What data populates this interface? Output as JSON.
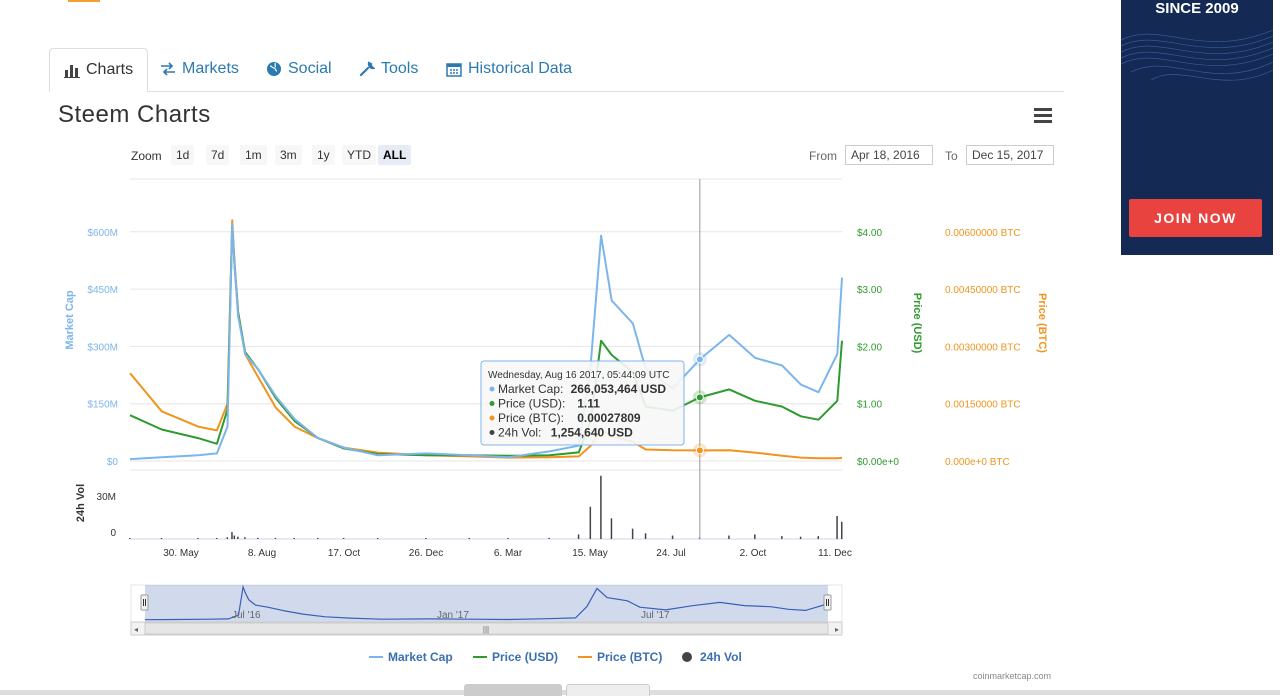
{
  "tabs": [
    {
      "label": "Charts",
      "icon": "bar-chart-icon",
      "active": true
    },
    {
      "label": "Markets",
      "icon": "exchange-icon",
      "active": false
    },
    {
      "label": "Social",
      "icon": "globe-icon",
      "active": false
    },
    {
      "label": "Tools",
      "icon": "wrench-icon",
      "active": false
    },
    {
      "label": "Historical Data",
      "icon": "calendar-icon",
      "active": false
    }
  ],
  "ad": {
    "headline": "SINCE 2009",
    "cta": "JOIN NOW"
  },
  "colors": {
    "market_cap": "#7cb5ec",
    "price_usd": "#2f9a2f",
    "price_btc": "#f0941f",
    "volume": "#434348",
    "navigator": "#3a5fb8"
  },
  "zoom": {
    "label": "Zoom",
    "buttons": [
      "1d",
      "7d",
      "1m",
      "3m",
      "1y",
      "YTD",
      "ALL"
    ],
    "selected": "ALL"
  },
  "range": {
    "from_label": "From",
    "from_value": "Apr 18, 2016",
    "to_label": "To",
    "to_value": "Dec 15, 2017"
  },
  "tooltip": {
    "date": "Wednesday, Aug 16 2017, 05:44:09 UTC",
    "rows": [
      {
        "label": "Market Cap:",
        "value": "266,053,464 USD"
      },
      {
        "label": "Price (USD):",
        "value": "1.11"
      },
      {
        "label": "Price (BTC):",
        "value": "0.00027809"
      },
      {
        "label": "24h Vol:",
        "value": "1,254,640 USD"
      }
    ]
  },
  "chart_data": {
    "type": "line",
    "title": "Steem Charts",
    "x_ticks": [
      "30. May",
      "8. Aug",
      "17. Oct",
      "26. Dec",
      "6. Mar",
      "15. May",
      "24. Jul",
      "2. Oct",
      "11. Dec"
    ],
    "axes": {
      "market_cap": {
        "label": "Market Cap",
        "ticks": [
          "$0",
          "$150M",
          "$300M",
          "$450M",
          "$600M"
        ],
        "range": [
          0,
          600000000
        ]
      },
      "price_usd": {
        "label": "Price (USD)",
        "ticks": [
          "$0.00e+0",
          "$1.00",
          "$2.00",
          "$3.00",
          "$4.00"
        ],
        "range": [
          0,
          4
        ]
      },
      "price_btc": {
        "label": "Price (BTC)",
        "ticks": [
          "0.000e+0 BTC",
          "0.00150000 BTC",
          "0.00300000 BTC",
          "0.00450000 BTC",
          "0.00600000 BTC"
        ],
        "range": [
          0,
          0.006
        ]
      },
      "volume": {
        "label": "24h Vol",
        "ticks": [
          "0",
          "30M"
        ],
        "range": [
          0,
          60000000
        ]
      }
    },
    "x": [
      "2016-04-18",
      "2016-05-15",
      "2016-06-15",
      "2016-07-01",
      "2016-07-10",
      "2016-07-14",
      "2016-07-16",
      "2016-07-19",
      "2016-07-25",
      "2016-08-05",
      "2016-08-20",
      "2016-09-05",
      "2016-09-25",
      "2016-10-17",
      "2016-11-15",
      "2016-12-26",
      "2017-02-01",
      "2017-03-06",
      "2017-04-10",
      "2017-05-05",
      "2017-05-15",
      "2017-05-24",
      "2017-06-02",
      "2017-06-20",
      "2017-07-01",
      "2017-07-24",
      "2017-08-16",
      "2017-09-10",
      "2017-10-02",
      "2017-10-25",
      "2017-11-10",
      "2017-11-25",
      "2017-12-11",
      "2017-12-15"
    ],
    "series": [
      {
        "name": "Market Cap",
        "axis": "market_cap",
        "values": [
          5000000,
          10000000,
          15000000,
          20000000,
          90000000,
          620000000,
          510000000,
          380000000,
          280000000,
          240000000,
          170000000,
          110000000,
          60000000,
          35000000,
          15000000,
          20000000,
          15000000,
          10000000,
          25000000,
          40000000,
          250000000,
          590000000,
          420000000,
          360000000,
          240000000,
          190000000,
          266000000,
          330000000,
          270000000,
          250000000,
          200000000,
          180000000,
          280000000,
          480000000
        ]
      },
      {
        "name": "Price (USD)",
        "axis": "price_usd",
        "values": [
          0.8,
          0.55,
          0.4,
          0.3,
          0.9,
          4.1,
          3.4,
          2.6,
          1.9,
          1.6,
          1.1,
          0.7,
          0.4,
          0.22,
          0.12,
          0.1,
          0.1,
          0.09,
          0.1,
          0.15,
          0.7,
          2.1,
          1.85,
          1.55,
          0.95,
          0.88,
          1.11,
          1.25,
          1.05,
          0.95,
          0.78,
          0.72,
          1.05,
          2.1
        ]
      },
      {
        "name": "Price (BTC)",
        "axis": "price_btc",
        "values": [
          0.0023,
          0.0013,
          0.0009,
          0.0008,
          0.0015,
          0.0063,
          0.0052,
          0.0039,
          0.0028,
          0.0022,
          0.0014,
          0.0009,
          0.0006,
          0.00035,
          0.00022,
          0.00015,
          0.00012,
          9e-05,
          0.0001,
          0.00012,
          0.0004,
          0.0008,
          0.00065,
          0.0005,
          0.0003,
          0.00028,
          0.00027809,
          0.00028,
          0.00022,
          0.00014,
          9e-05,
          7e-05,
          7e-05,
          8e-05
        ]
      },
      {
        "name": "24h Vol",
        "axis": "volume",
        "values": [
          200000,
          300000,
          300000,
          500000,
          1500000,
          6000000,
          3000000,
          2000000,
          1500000,
          1000000,
          600000,
          400000,
          300000,
          200000,
          150000,
          150000,
          200000,
          500000,
          900000,
          4000000,
          28000000,
          55000000,
          18000000,
          9000000,
          5000000,
          3000000,
          1254640,
          3000000,
          4000000,
          2500000,
          2000000,
          2500000,
          20000000,
          15000000
        ]
      }
    ],
    "navigator_ticks": [
      "Jul '16",
      "Jan '17",
      "Jul '17"
    ],
    "legend": [
      {
        "name": "Market Cap",
        "symbol": "line"
      },
      {
        "name": "Price (USD)",
        "symbol": "line"
      },
      {
        "name": "Price (BTC)",
        "symbol": "line"
      },
      {
        "name": "24h Vol",
        "symbol": "dot"
      }
    ],
    "legend_position": "bottom-center",
    "grid": true
  },
  "credit": "coinmarketcap.com"
}
